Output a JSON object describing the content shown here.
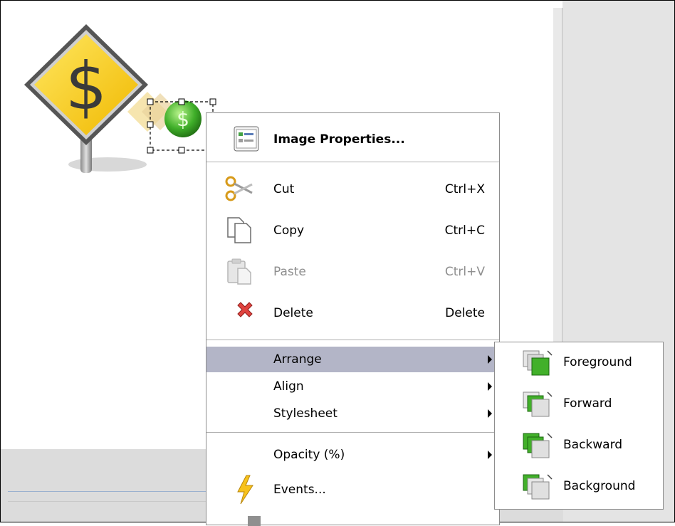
{
  "context_menu": {
    "image_properties": {
      "label": "Image Properties...",
      "icon": "properties-icon"
    },
    "cut": {
      "label": "Cut",
      "shortcut": "Ctrl+X",
      "icon": "scissors-icon"
    },
    "copy": {
      "label": "Copy",
      "shortcut": "Ctrl+C",
      "icon": "copy-icon"
    },
    "paste": {
      "label": "Paste",
      "shortcut": "Ctrl+V",
      "icon": "paste-icon",
      "disabled": true
    },
    "delete": {
      "label": "Delete",
      "shortcut": "Delete",
      "icon": "delete-icon"
    },
    "arrange": {
      "label": "Arrange",
      "highlighted": true
    },
    "align": {
      "label": "Align"
    },
    "stylesheet": {
      "label": "Stylesheet"
    },
    "opacity": {
      "label": "Opacity (%)"
    },
    "events": {
      "label": "Events...",
      "icon": "lightning-icon"
    }
  },
  "arrange_submenu": {
    "items": [
      {
        "label": "Foreground",
        "icon": "bring-to-front-icon"
      },
      {
        "label": "Forward",
        "icon": "bring-forward-icon"
      },
      {
        "label": "Backward",
        "icon": "send-backward-icon"
      },
      {
        "label": "Background",
        "icon": "send-to-back-icon"
      }
    ]
  },
  "colors": {
    "highlight": "#b3b5c7",
    "sign_yellow": "#f5d21e",
    "green": "#3fae29"
  }
}
